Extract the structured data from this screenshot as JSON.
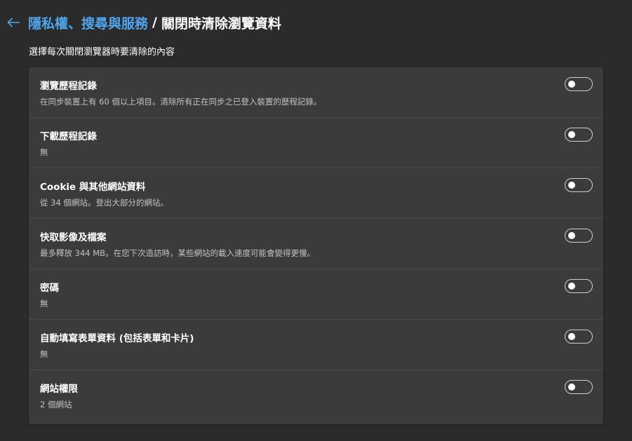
{
  "header": {
    "back_icon": "arrow-left-icon",
    "parent_label": "隱私權、搜尋與服務",
    "separator": "/",
    "current_label": "關閉時清除瀏覽資料"
  },
  "subtitle": "選擇每次關閉瀏覽器時要清除的內容",
  "colors": {
    "background": "#2b2b2b",
    "card": "#3b3b3b",
    "link": "#4fa6ee",
    "secondary_text": "#c2c2c2"
  },
  "items": [
    {
      "title": "瀏覽歷程記錄",
      "description": "在同步裝置上有 60 個以上項目。清除所有正在同步之已登入裝置的歷程記錄。",
      "enabled": false
    },
    {
      "title": "下載歷程記錄",
      "description": "無",
      "enabled": false
    },
    {
      "title": "Cookie 與其他網站資料",
      "description": "從 34 個網站。登出大部分的網站。",
      "enabled": false
    },
    {
      "title": "快取影像及檔案",
      "description": "最多釋放 344 MB。在您下次造訪時，某些網站的載入速度可能會變得更慢。",
      "enabled": false
    },
    {
      "title": "密碼",
      "description": "無",
      "enabled": false
    },
    {
      "title": "自動填寫表單資料 (包括表單和卡片)",
      "description": "無",
      "enabled": false
    },
    {
      "title": "網站權限",
      "description": "2 個網站",
      "enabled": false
    }
  ]
}
